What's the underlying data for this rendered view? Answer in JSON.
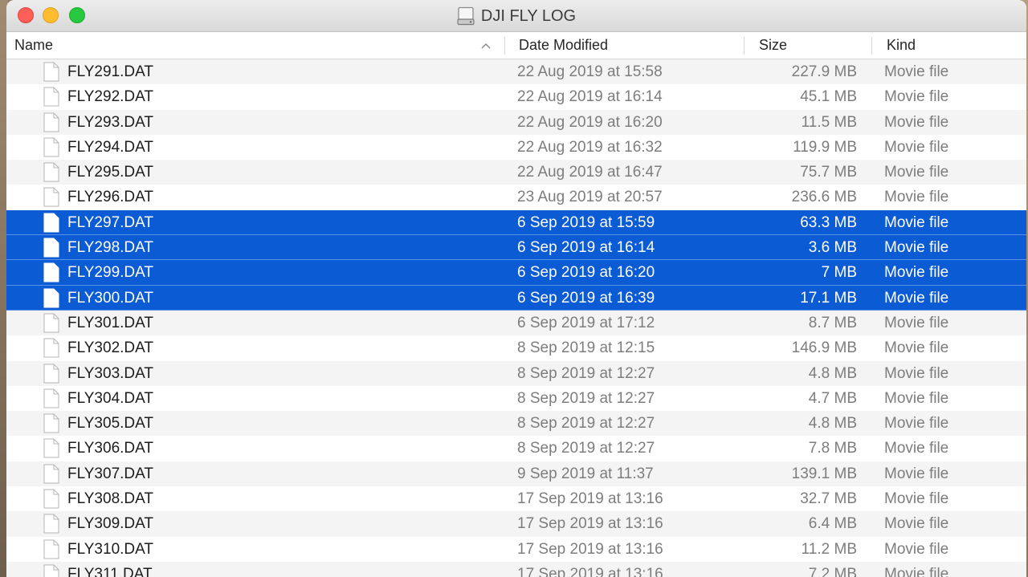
{
  "window": {
    "title": "DJI FLY LOG",
    "title_icon": "external-drive-icon"
  },
  "columns": {
    "name": "Name",
    "date": "Date Modified",
    "size": "Size",
    "kind": "Kind",
    "sort_indicator": "^"
  },
  "colors": {
    "selection": "#0a5bd4",
    "close": "#ff5f57",
    "minimize": "#febc2e",
    "zoom": "#28c840"
  },
  "files": [
    {
      "name": "FLY291.DAT",
      "date": "22 Aug 2019 at 15:58",
      "size": "227.9 MB",
      "kind": "Movie file",
      "selected": false
    },
    {
      "name": "FLY292.DAT",
      "date": "22 Aug 2019 at 16:14",
      "size": "45.1 MB",
      "kind": "Movie file",
      "selected": false
    },
    {
      "name": "FLY293.DAT",
      "date": "22 Aug 2019 at 16:20",
      "size": "11.5 MB",
      "kind": "Movie file",
      "selected": false
    },
    {
      "name": "FLY294.DAT",
      "date": "22 Aug 2019 at 16:32",
      "size": "119.9 MB",
      "kind": "Movie file",
      "selected": false
    },
    {
      "name": "FLY295.DAT",
      "date": "22 Aug 2019 at 16:47",
      "size": "75.7 MB",
      "kind": "Movie file",
      "selected": false
    },
    {
      "name": "FLY296.DAT",
      "date": "23 Aug 2019 at 20:57",
      "size": "236.6 MB",
      "kind": "Movie file",
      "selected": false
    },
    {
      "name": "FLY297.DAT",
      "date": "6 Sep 2019 at 15:59",
      "size": "63.3 MB",
      "kind": "Movie file",
      "selected": true
    },
    {
      "name": "FLY298.DAT",
      "date": "6 Sep 2019 at 16:14",
      "size": "3.6 MB",
      "kind": "Movie file",
      "selected": true
    },
    {
      "name": "FLY299.DAT",
      "date": "6 Sep 2019 at 16:20",
      "size": "7 MB",
      "kind": "Movie file",
      "selected": true
    },
    {
      "name": "FLY300.DAT",
      "date": "6 Sep 2019 at 16:39",
      "size": "17.1 MB",
      "kind": "Movie file",
      "selected": true
    },
    {
      "name": "FLY301.DAT",
      "date": "6 Sep 2019 at 17:12",
      "size": "8.7 MB",
      "kind": "Movie file",
      "selected": false
    },
    {
      "name": "FLY302.DAT",
      "date": "8 Sep 2019 at 12:15",
      "size": "146.9 MB",
      "kind": "Movie file",
      "selected": false
    },
    {
      "name": "FLY303.DAT",
      "date": "8 Sep 2019 at 12:27",
      "size": "4.8 MB",
      "kind": "Movie file",
      "selected": false
    },
    {
      "name": "FLY304.DAT",
      "date": "8 Sep 2019 at 12:27",
      "size": "4.7 MB",
      "kind": "Movie file",
      "selected": false
    },
    {
      "name": "FLY305.DAT",
      "date": "8 Sep 2019 at 12:27",
      "size": "4.8 MB",
      "kind": "Movie file",
      "selected": false
    },
    {
      "name": "FLY306.DAT",
      "date": "8 Sep 2019 at 12:27",
      "size": "7.8 MB",
      "kind": "Movie file",
      "selected": false
    },
    {
      "name": "FLY307.DAT",
      "date": "9 Sep 2019 at 11:37",
      "size": "139.1 MB",
      "kind": "Movie file",
      "selected": false
    },
    {
      "name": "FLY308.DAT",
      "date": "17 Sep 2019 at 13:16",
      "size": "32.7 MB",
      "kind": "Movie file",
      "selected": false
    },
    {
      "name": "FLY309.DAT",
      "date": "17 Sep 2019 at 13:16",
      "size": "6.4 MB",
      "kind": "Movie file",
      "selected": false
    },
    {
      "name": "FLY310.DAT",
      "date": "17 Sep 2019 at 13:16",
      "size": "11.2 MB",
      "kind": "Movie file",
      "selected": false
    },
    {
      "name": "FLY311.DAT",
      "date": "17 Sep 2019 at 13:16",
      "size": "7.2 MB",
      "kind": "Movie file",
      "selected": false
    }
  ]
}
